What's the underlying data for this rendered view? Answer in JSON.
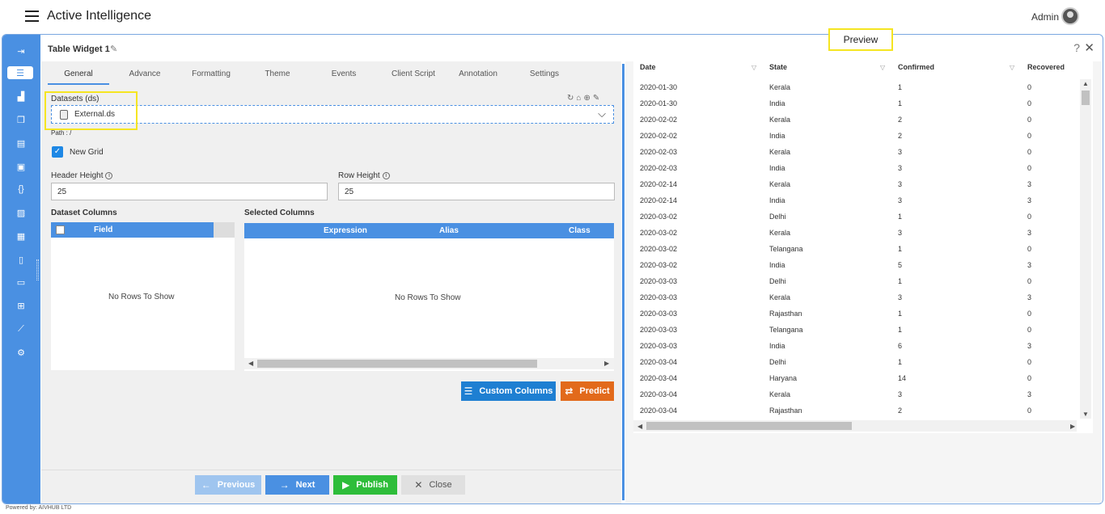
{
  "app": {
    "title": "Active Intelligence",
    "user": "Admin",
    "powered_by": "Powered by: AIVHUB LTD"
  },
  "panel": {
    "title": "Table Widget 1",
    "help": "?",
    "close": "✕"
  },
  "tabs": [
    "General",
    "Advance",
    "Formatting",
    "Theme",
    "Events",
    "Client Script",
    "Annotation",
    "Settings"
  ],
  "general": {
    "datasets_label": "Datasets (ds)",
    "dataset_value": "External.ds",
    "path_label": "Path : /",
    "new_grid_label": "New Grid",
    "header_height_label": "Header Height",
    "header_height_value": "25",
    "row_height_label": "Row Height",
    "row_height_value": "25",
    "dataset_columns_label": "Dataset Columns",
    "selected_columns_label": "Selected Columns",
    "dataset_grid": {
      "headers": [
        "Field"
      ],
      "empty": "No Rows To Show"
    },
    "selected_grid": {
      "headers": [
        "Expression",
        "Alias",
        "Class"
      ],
      "empty": "No Rows To Show"
    },
    "custom_columns_button": "Custom Columns",
    "predict_button": "Predict"
  },
  "footer": {
    "previous": "Previous",
    "next": "Next",
    "publish": "Publish",
    "close": "Close"
  },
  "preview": {
    "title": "Preview",
    "columns": [
      "Date",
      "State",
      "Confirmed",
      "Recovered"
    ],
    "rows": [
      [
        "2020-01-30",
        "Kerala",
        "1",
        "0"
      ],
      [
        "2020-01-30",
        "India",
        "1",
        "0"
      ],
      [
        "2020-02-02",
        "Kerala",
        "2",
        "0"
      ],
      [
        "2020-02-02",
        "India",
        "2",
        "0"
      ],
      [
        "2020-02-03",
        "Kerala",
        "3",
        "0"
      ],
      [
        "2020-02-03",
        "India",
        "3",
        "0"
      ],
      [
        "2020-02-14",
        "Kerala",
        "3",
        "3"
      ],
      [
        "2020-02-14",
        "India",
        "3",
        "3"
      ],
      [
        "2020-03-02",
        "Delhi",
        "1",
        "0"
      ],
      [
        "2020-03-02",
        "Kerala",
        "3",
        "3"
      ],
      [
        "2020-03-02",
        "Telangana",
        "1",
        "0"
      ],
      [
        "2020-03-02",
        "India",
        "5",
        "3"
      ],
      [
        "2020-03-03",
        "Delhi",
        "1",
        "0"
      ],
      [
        "2020-03-03",
        "Kerala",
        "3",
        "3"
      ],
      [
        "2020-03-03",
        "Rajasthan",
        "1",
        "0"
      ],
      [
        "2020-03-03",
        "Telangana",
        "1",
        "0"
      ],
      [
        "2020-03-03",
        "India",
        "6",
        "3"
      ],
      [
        "2020-03-04",
        "Delhi",
        "1",
        "0"
      ],
      [
        "2020-03-04",
        "Haryana",
        "14",
        "0"
      ],
      [
        "2020-03-04",
        "Kerala",
        "3",
        "3"
      ],
      [
        "2020-03-04",
        "Rajasthan",
        "2",
        "0"
      ]
    ]
  }
}
